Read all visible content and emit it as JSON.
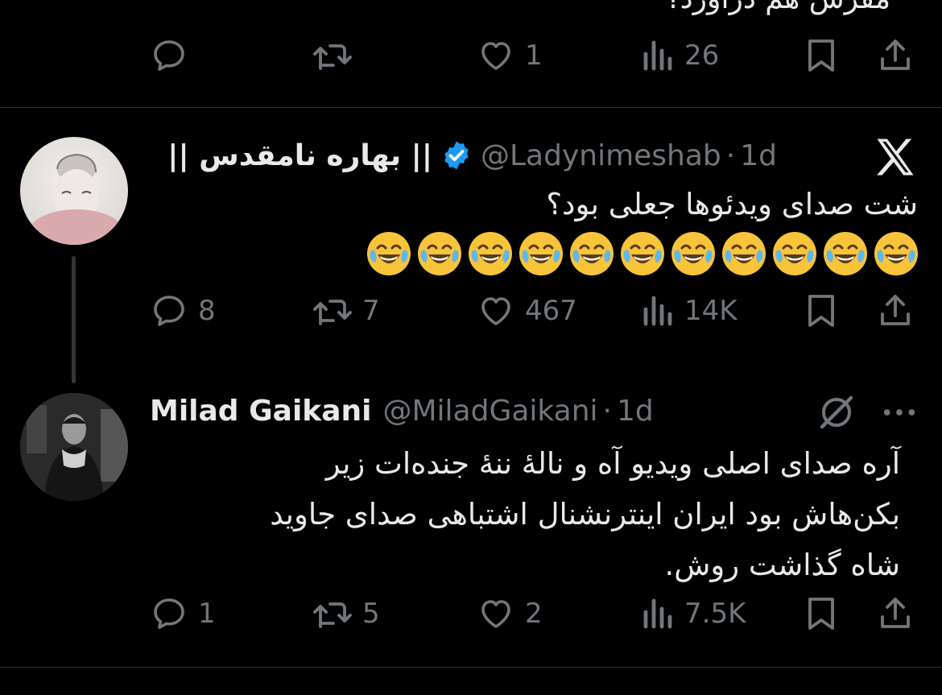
{
  "top_tweet": {
    "cut_text": "مقرش هم درآورد؟",
    "actions": {
      "replies": "",
      "reposts": "",
      "likes": "1",
      "views": "26"
    }
  },
  "tweet1": {
    "name": "|| بهاره نامقدس ||",
    "handle": "@Ladynimeshab",
    "separator": "·",
    "time": "1d",
    "text": "شت صدای ویدئوها جعلی بود؟",
    "emoji_count": 11,
    "actions": {
      "replies": "8",
      "reposts": "7",
      "likes": "467",
      "views": "14K"
    }
  },
  "tweet2": {
    "name": "Milad Gaikani",
    "handle": "@MiladGaikani",
    "separator": "·",
    "time": "1d",
    "text_lines": [
      "آره صدای اصلی ویدیو آه و نالهٔ ننهٔ جنده‌ات زیر",
      "بکن‌هاش بود ایران اینترنشنال اشتباهی صدای جاوید",
      "شاه گذاشت روش."
    ],
    "actions": {
      "replies": "1",
      "reposts": "5",
      "likes": "2",
      "views": "7.5K"
    }
  },
  "colors": {
    "background": "#000000",
    "text": "#e7e9ea",
    "muted": "#71767b",
    "verified": "#1d9bf0"
  }
}
